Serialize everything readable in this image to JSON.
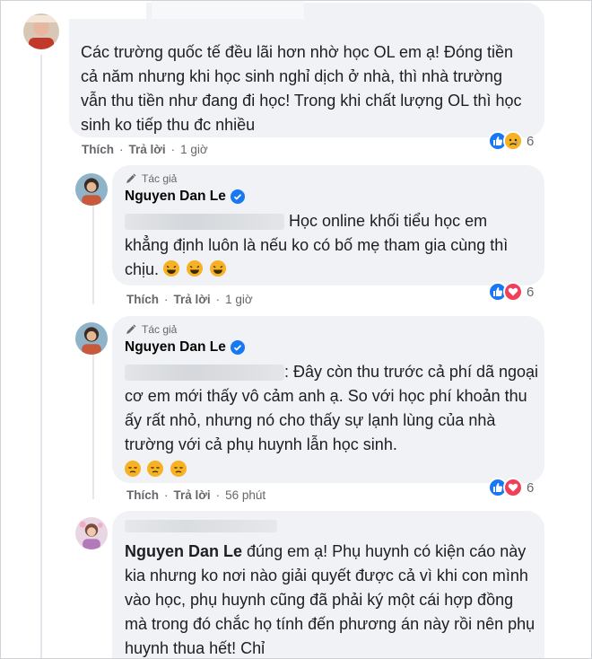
{
  "comments": [
    {
      "text": "Các trường quốc tế đều lãi hơn nhờ học OL em ạ! Đóng tiền cả năm nhưng khi học sinh nghỉ dịch ở nhà, thì nhà trường vẫn thu tiền như đang đi học! Trong khi chất lượng OL thì học sinh ko tiếp thu đc nhiều",
      "like_label": "Thích",
      "reply_label": "Trả lời",
      "time": "1 giờ",
      "reaction_count": "6"
    },
    {
      "author_tag": "Tác giả",
      "author": "Nguyen Dan Le",
      "text": "Học online khối tiểu học em khẳng định luôn là nếu ko có bố mẹ tham gia cùng thì chịu.",
      "like_label": "Thích",
      "reply_label": "Trả lời",
      "time": "1 giờ",
      "reaction_count": "6"
    },
    {
      "author_tag": "Tác giả",
      "author": "Nguyen Dan Le",
      "text": ": Đây còn thu trước cả phí dã ngoại cơ em mới thấy vô cảm anh ạ. So với học phí khoản thu ấy rất nhỏ, nhưng nó cho thấy sự lạnh lùng của nhà trường với cả phụ huynh lẫn học sinh.",
      "like_label": "Thích",
      "reply_label": "Trả lời",
      "time": "56 phút",
      "reaction_count": "6"
    },
    {
      "mention": "Nguyen Dan Le",
      "text": " đúng em ạ! Phụ huynh có kiện cáo này kia nhưng ko nơi nào giải quyết được cả vì khi con mình vào học, phụ huynh cũng đã phải ký một cái hợp đồng mà trong đó chắc họ tính đến phương án này rồi nên phụ huynh thua hết! Chỉ"
    }
  ],
  "icons": {
    "like": "like-reaction-icon",
    "sad": "sad-reaction-icon",
    "love": "love-reaction-icon",
    "laugh": "laugh-emoji-icon",
    "sad_face": "sad-emoji-icon",
    "pen": "pen-icon",
    "verified": "verified-badge-icon"
  },
  "colors": {
    "like": "#1877f2",
    "love": "#f33e58",
    "sad": "#f7b125",
    "verified": "#1877f2"
  }
}
